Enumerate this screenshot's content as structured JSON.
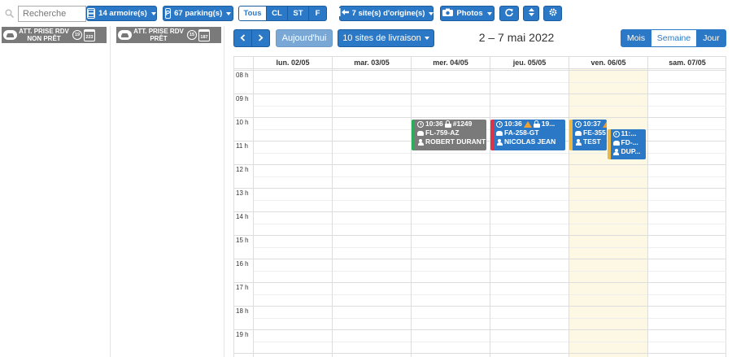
{
  "toolbar": {
    "search_placeholder": "Recherche",
    "lockers_label": "14 armoire(s)",
    "parkings_label": "67 parking(s)",
    "filter_options": [
      "Tous",
      "CL",
      "ST",
      "F"
    ],
    "filter_active": "Tous",
    "origin_sites_label": "7 site(s) d'origine(s)",
    "photos_label": "Photos",
    "icons": [
      "search-icon",
      "locker-icon",
      "parking-icon",
      "arrow-left-icon",
      "camera-icon",
      "refresh-icon",
      "sort-icon",
      "gear-icon"
    ]
  },
  "status_columns": [
    {
      "label_line1": "ATT. PRISE RDV",
      "label_line2": "NON PRÊT",
      "count": "19",
      "calendar_count": "223"
    },
    {
      "label_line1": "ATT. PRISE RDV",
      "label_line2": "PRÊT",
      "count": "15",
      "calendar_count": "187"
    }
  ],
  "calendar": {
    "today_label": "Aujourd'hui",
    "delivery_sites_label": "10 sites de livraison",
    "title": "2 – 7 mai 2022",
    "views": [
      "Mois",
      "Semaine",
      "Jour"
    ],
    "active_view": "Semaine",
    "days": [
      "lun. 02/05",
      "mar. 03/05",
      "mer. 04/05",
      "jeu. 05/05",
      "ven. 06/05",
      "sam. 07/05"
    ],
    "today_index": 4,
    "hours": [
      "08 h",
      "09 h",
      "10 h",
      "11 h",
      "12 h",
      "13 h",
      "14 h",
      "15 h",
      "16 h",
      "17 h",
      "18 h",
      "19 h"
    ]
  },
  "events": [
    {
      "time": "10:36",
      "ref": "#1249",
      "plate": "FL-759-AZ",
      "client": "ROBERT DURANT",
      "warning": false,
      "color": "#7a7a7a",
      "border": "#2eab5a"
    },
    {
      "time": "10:36",
      "ref": "19...",
      "plate": "FA-258-GT",
      "client": "NICOLAS JEAN",
      "warning": true,
      "color": "#2a78c6",
      "border": "#d9344a"
    },
    {
      "time": "10:37",
      "ref": "126",
      "plate": "FE-355",
      "client": "TEST",
      "warning": true,
      "color": "#2a78c6",
      "border": "#e8b84a"
    },
    {
      "time": "11:...",
      "ref": "",
      "plate": "FD-...",
      "client": "DUP...",
      "warning": false,
      "color": "#2a78c6",
      "border": "#e8b84a"
    }
  ],
  "colors": {
    "primary": "#2a78c6",
    "today_bg": "#fcf8e3",
    "status_gray": "#7a7a7a"
  }
}
